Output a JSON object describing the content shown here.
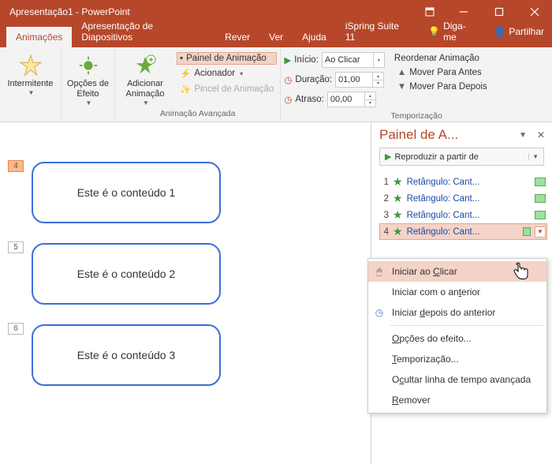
{
  "title": "Apresentação1 - PowerPoint",
  "tabs": {
    "animacoes": "Animações",
    "apresentacao": "Apresentação de Diapositivos",
    "rever": "Rever",
    "ver": "Ver",
    "ajuda": "Ajuda",
    "ispring": "iSpring Suite 11",
    "digame": "Diga-me",
    "partilhar": "Partilhar"
  },
  "ribbon": {
    "effect": "Intermitente",
    "effect_options": "Opções de Efeito",
    "add_anim": "Adicionar Animação",
    "anim_pane": "Painel de Animação",
    "trigger": "Acionador",
    "painter": "Pincel de Animação",
    "adv_group": "Animação Avançada",
    "start": "Início:",
    "start_val": "Ao Clicar",
    "duration": "Duração:",
    "duration_val": "01,00",
    "delay": "Atraso:",
    "delay_val": "00,00",
    "reorder": "Reordenar Animação",
    "move_before": "Mover Para Antes",
    "move_after": "Mover Para Depois",
    "timing_group": "Temporização"
  },
  "slide": {
    "badges": [
      "4",
      "5",
      "6"
    ],
    "items": [
      "Este é o conteúdo 1",
      "Este é o conteúdo 2",
      "Este é o conteúdo 3"
    ]
  },
  "pane": {
    "title": "Painel de A...",
    "play": "Reproduzir a partir de",
    "items": [
      {
        "num": "1",
        "label": "Retângulo: Cant..."
      },
      {
        "num": "2",
        "label": "Retângulo: Cant..."
      },
      {
        "num": "3",
        "label": "Retângulo: Cant..."
      },
      {
        "num": "4",
        "label": "Retângulo: Cant..."
      }
    ]
  },
  "menu": {
    "start_click": "Iniciar ao Clicar",
    "start_with": "Iniciar com o anterior",
    "start_after": "Iniciar depois do anterior",
    "effect_opts": "Opções do efeito...",
    "timing": "Temporização...",
    "hide_timeline": "Ocultar linha de tempo avançada",
    "remove": "Remover"
  }
}
